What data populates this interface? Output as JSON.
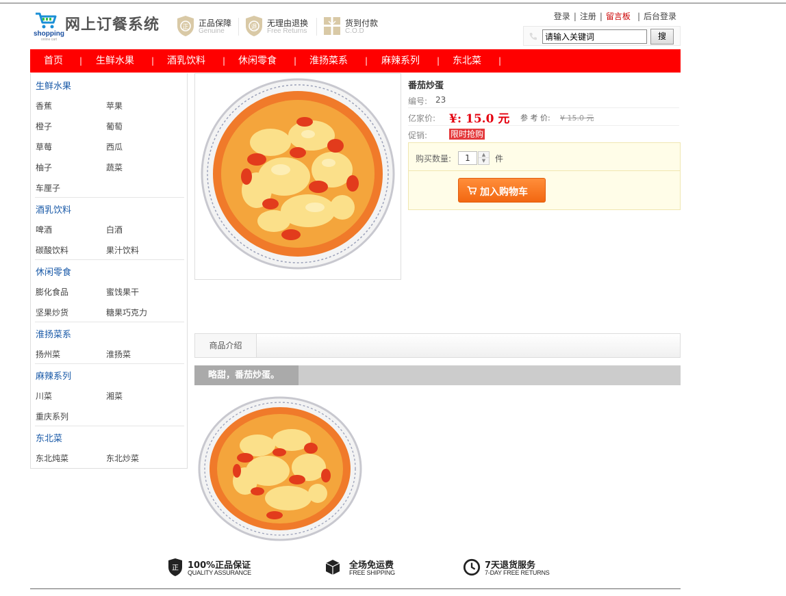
{
  "header": {
    "logo_word": "shopping",
    "logo_sub": "online cart",
    "site_title": "网上订餐系统",
    "promos": [
      {
        "icon": "shield-genuine-icon",
        "title": "正品保障",
        "subtitle": "Genuine"
      },
      {
        "icon": "return-icon",
        "title": "无理由退换",
        "subtitle": "Free Returns"
      },
      {
        "icon": "gift-cod-icon",
        "title": "货到付款",
        "subtitle": "C.O.D"
      }
    ],
    "links": {
      "login": "登录",
      "register": "注册",
      "message_board": "留言板",
      "admin_login": "后台登录",
      "separator": "|"
    },
    "search": {
      "value": "请输入关键词",
      "button": "搜"
    }
  },
  "nav": {
    "items": [
      "首页",
      "生鲜水果",
      "酒乳饮料",
      "休闲零食",
      "淮扬菜系",
      "麻辣系列",
      "东北菜"
    ],
    "separator": "|"
  },
  "sidebar": {
    "categories": [
      {
        "title": "生鲜水果",
        "items": [
          "香蕉",
          "苹果",
          "橙子",
          "葡萄",
          "草莓",
          "西瓜",
          "柚子",
          "蔬菜",
          "车厘子"
        ]
      },
      {
        "title": "酒乳饮料",
        "items": [
          "啤酒",
          "白酒",
          "碳酸饮料",
          "果汁饮料"
        ]
      },
      {
        "title": "休闲零食",
        "items": [
          "膨化食品",
          "蜜饯果干",
          "坚果炒货",
          "糖果巧克力"
        ]
      },
      {
        "title": "淮扬菜系",
        "items": [
          "扬州菜",
          "淮扬菜"
        ]
      },
      {
        "title": "麻辣系列",
        "items": [
          "川菜",
          "湘菜",
          "重庆系列"
        ]
      },
      {
        "title": "东北菜",
        "items": [
          "东北炖菜",
          "东北炒菜"
        ]
      }
    ]
  },
  "product": {
    "name": "番茄炒蛋",
    "code_label": "编号:",
    "code": "23",
    "price_label": "亿家价:",
    "price": "¥:  15.0 元",
    "ref_label": "参 考 价:",
    "ref_price": "¥ 15.0 元",
    "promo_label": "促销:",
    "promo_tag": "限时抢购",
    "qty_label": "购买数量:",
    "qty": "1",
    "qty_unit": "件",
    "add_to_cart": "加入购物车"
  },
  "tabs": [
    "商品介绍"
  ],
  "description": {
    "title": "略甜，番茄炒蛋。"
  },
  "footer": [
    {
      "icon": "genuine-badge-icon",
      "cn": "100%正品保证",
      "en": "QUALITY ASSURANCE"
    },
    {
      "icon": "box-icon",
      "cn": "全场免运费",
      "en": "FREE SHIPPING"
    },
    {
      "icon": "clock-icon",
      "cn": "7天退货服务",
      "en": "7-DAY FREE RETURNS"
    }
  ],
  "colors": {
    "nav_bg": "#ff0000",
    "price": "#e4000f",
    "link_blue": "#1a5aa8",
    "cart_button": "#f26711"
  }
}
